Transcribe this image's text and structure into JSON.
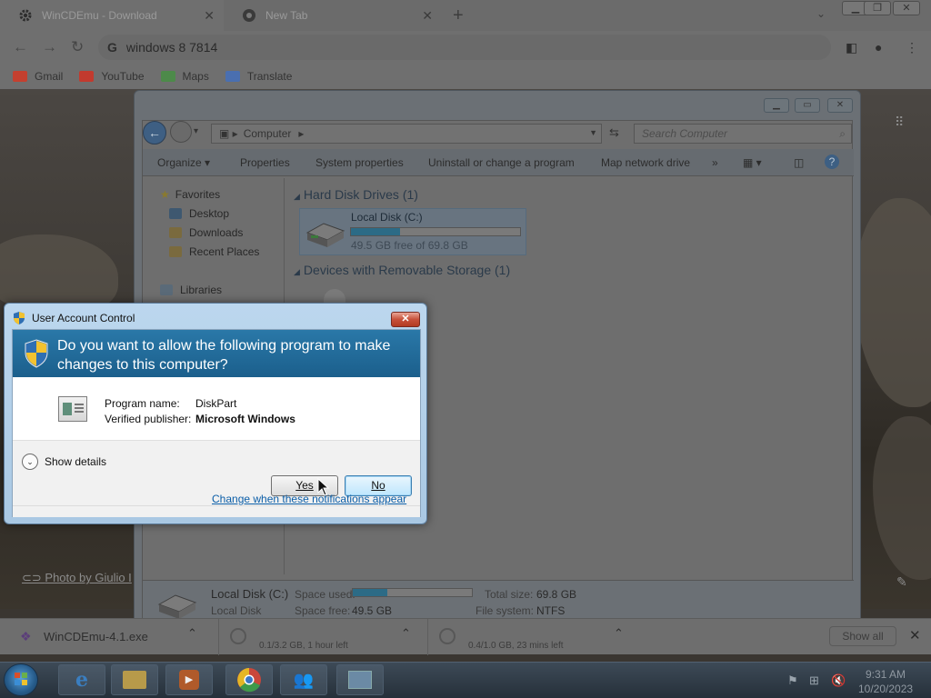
{
  "browser": {
    "tabs": [
      {
        "title": "WinCDEmu - Download",
        "icon": "gear-icon"
      },
      {
        "title": "New Tab",
        "icon": "chrome-icon"
      }
    ],
    "omnibox_text": "windows 8 7814",
    "bookmarks": [
      {
        "label": "Gmail",
        "color": "#c4402f"
      },
      {
        "label": "YouTube",
        "color": "#c23a2e"
      },
      {
        "label": "Maps",
        "color": "#4d8a4a"
      },
      {
        "label": "Translate",
        "color": "#4a6fb0"
      }
    ],
    "photo_credit": "Photo by Giulio I"
  },
  "downloads": {
    "items": [
      {
        "name": "WinCDEmu-4.1.exe",
        "status": ""
      },
      {
        "name": "",
        "status": "0.1/3.2 GB, 1 hour left"
      },
      {
        "name": "",
        "status": "0.4/1.0 GB, 23 mins left"
      }
    ],
    "show_all_label": "Show all"
  },
  "explorer": {
    "breadcrumb": "Computer",
    "search_placeholder": "Search Computer",
    "commands": [
      "Organize ▾",
      "Properties",
      "System properties",
      "Uninstall or change a program",
      "Map network drive",
      "»"
    ],
    "nav": [
      "Favorites",
      "Desktop",
      "Downloads",
      "Recent Places",
      "Libraries"
    ],
    "groups": {
      "hard_disks": "Hard Disk Drives (1)",
      "removable": "Devices with Removable Storage (1)"
    },
    "disk": {
      "name": "Local Disk (C:)",
      "free_text": "49.5 GB free of 69.8 GB",
      "used_fraction": 0.29
    },
    "details": {
      "name": "Local Disk (C:)",
      "type": "Local Disk",
      "space_used_label": "Space used:",
      "space_free_label": "Space free:",
      "space_free": "49.5 GB",
      "total_size_label": "Total size:",
      "total_size": "69.8 GB",
      "file_system_label": "File system:",
      "file_system": "NTFS"
    }
  },
  "uac": {
    "title": "User Account Control",
    "question": "Do you want to allow the following program to make changes to this computer?",
    "program_name_label": "Program name:",
    "program_name": "DiskPart",
    "publisher_label": "Verified publisher:",
    "publisher": "Microsoft Windows",
    "show_details": "Show details",
    "yes_label": "Yes",
    "no_label": "No",
    "notifications_link": "Change when these notifications appear",
    "colors": {
      "banner": "#1f6794",
      "link": "#0b5ea8",
      "close": "#c7503a"
    }
  },
  "taskbar": {
    "time": "9:31 AM",
    "date": "10/20/2023"
  }
}
